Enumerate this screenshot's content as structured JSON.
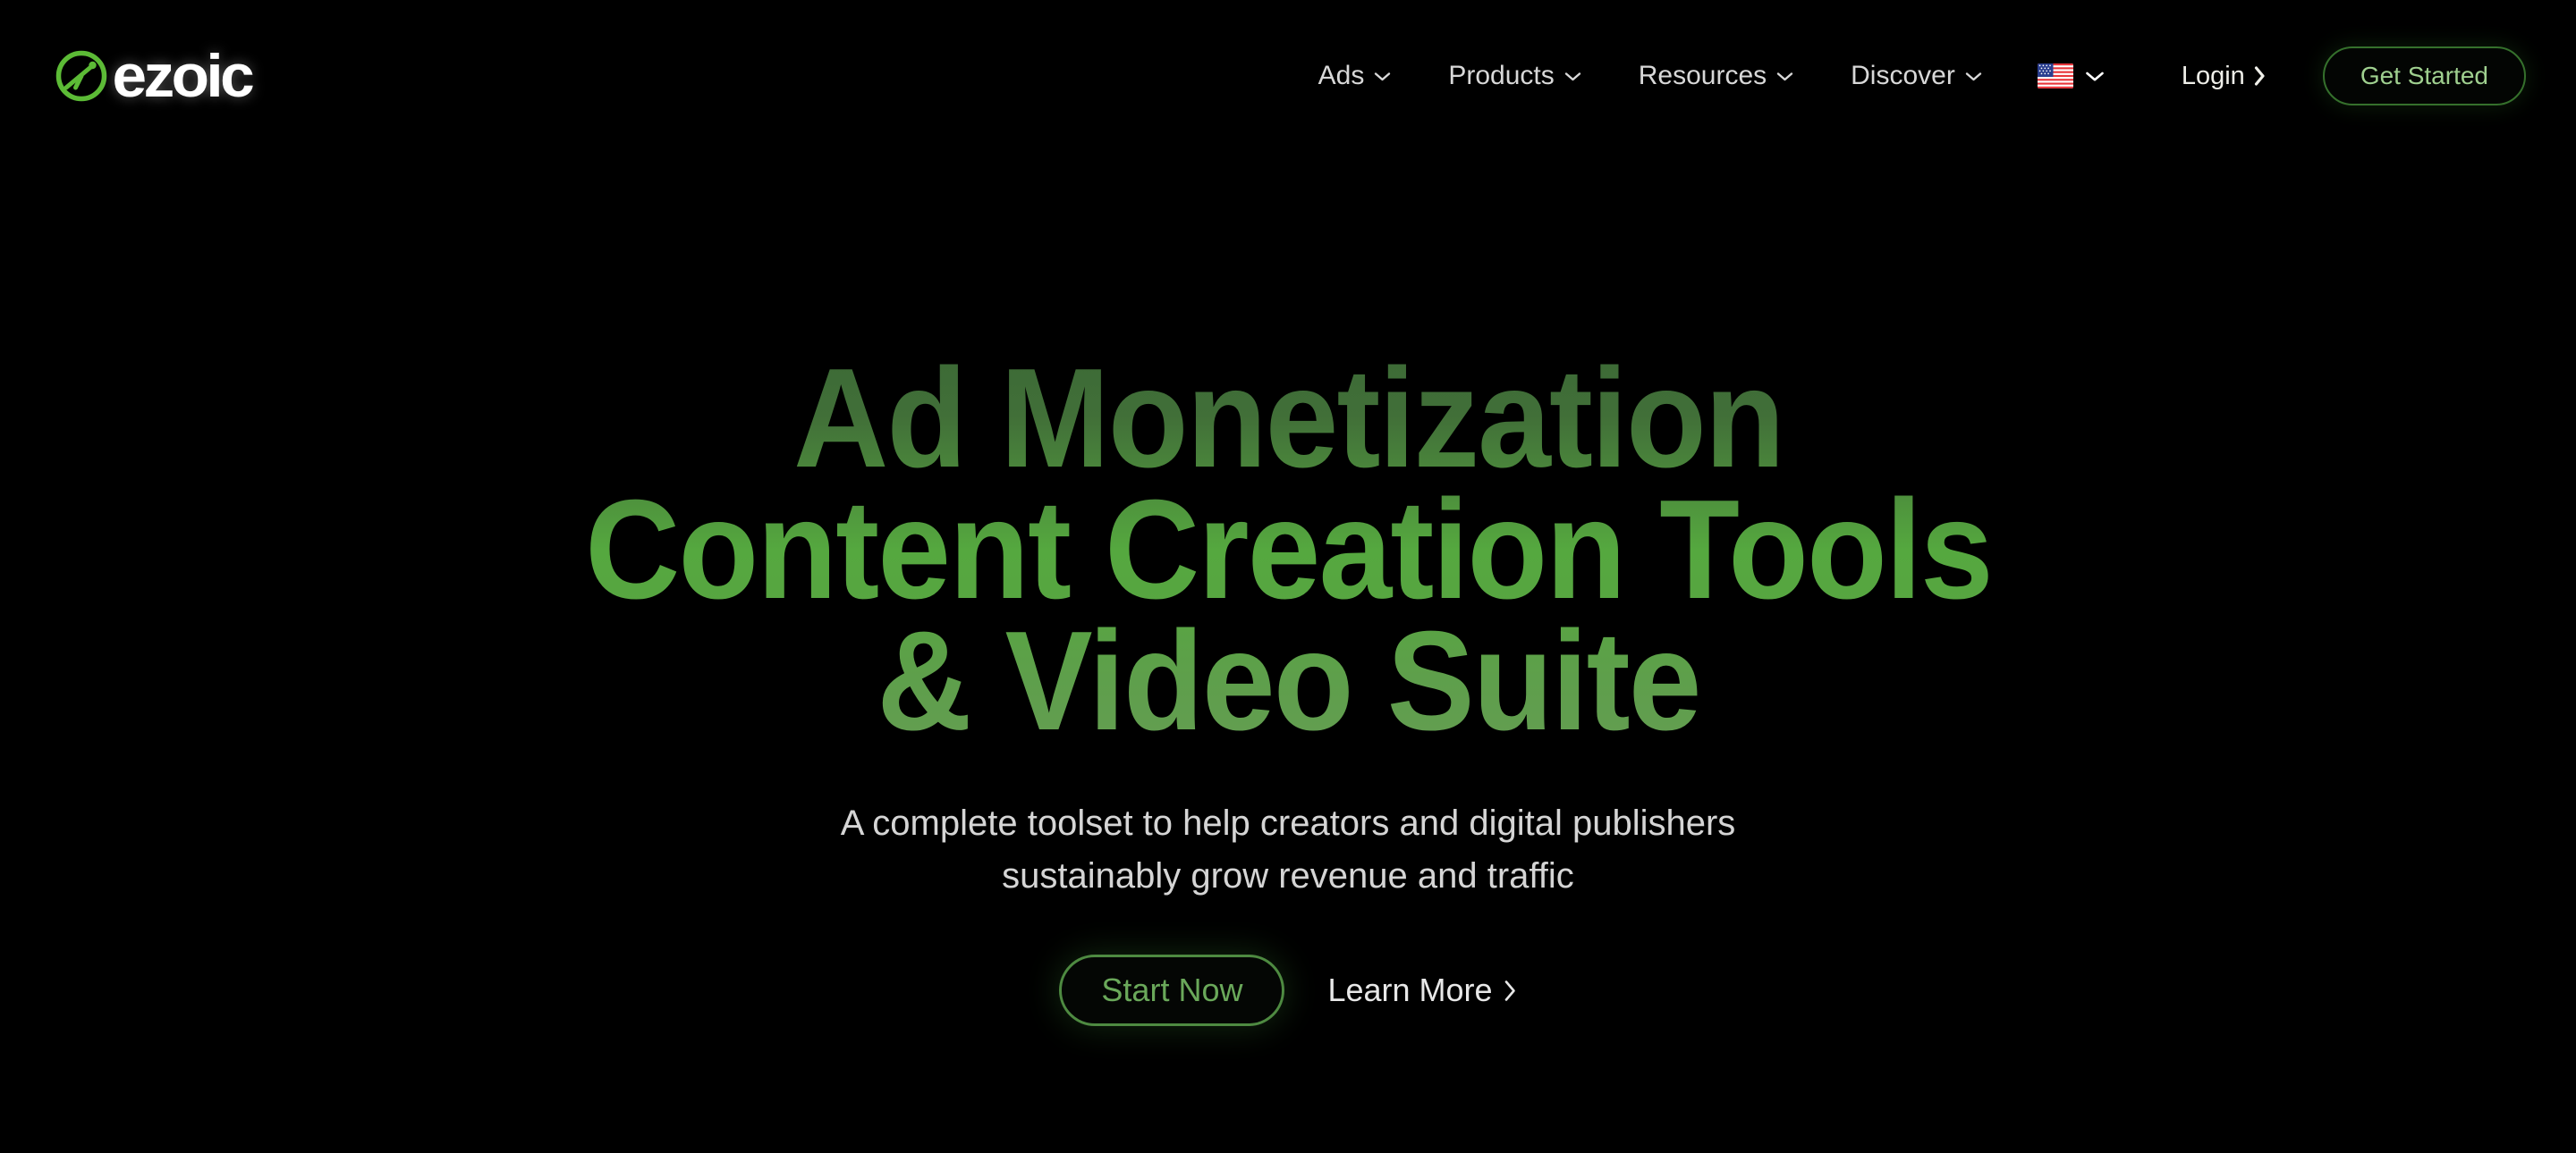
{
  "brand": {
    "name": "ezoic",
    "mark_icon": "ezoic-circle-logo-icon",
    "accent_green": "#55a83f",
    "logo_green": "#5cbb36"
  },
  "header": {
    "nav": [
      {
        "label": "Ads",
        "icon": "chevron-down-icon"
      },
      {
        "label": "Products",
        "icon": "chevron-down-icon"
      },
      {
        "label": "Resources",
        "icon": "chevron-down-icon"
      },
      {
        "label": "Discover",
        "icon": "chevron-down-icon"
      }
    ],
    "locale": {
      "flag_icon": "us-flag-icon",
      "chevron_icon": "chevron-down-icon"
    },
    "login": {
      "label": "Login",
      "icon": "chevron-right-icon"
    },
    "get_started": {
      "label": "Get Started",
      "border_color": "#35702c",
      "text_color": "#9fd08f"
    }
  },
  "hero": {
    "headline": [
      "Ad Monetization",
      "Content Creation Tools",
      "& Video Suite"
    ],
    "subheading": [
      "A complete toolset to help creators and digital publishers",
      "sustainably grow revenue and traffic"
    ],
    "primary_cta": {
      "label": "Start Now",
      "border_color": "#4e8a41",
      "text_color": "#6aa85a"
    },
    "secondary_cta": {
      "label": "Learn More",
      "icon": "chevron-right-icon"
    }
  },
  "page": {
    "background": "#000000"
  }
}
